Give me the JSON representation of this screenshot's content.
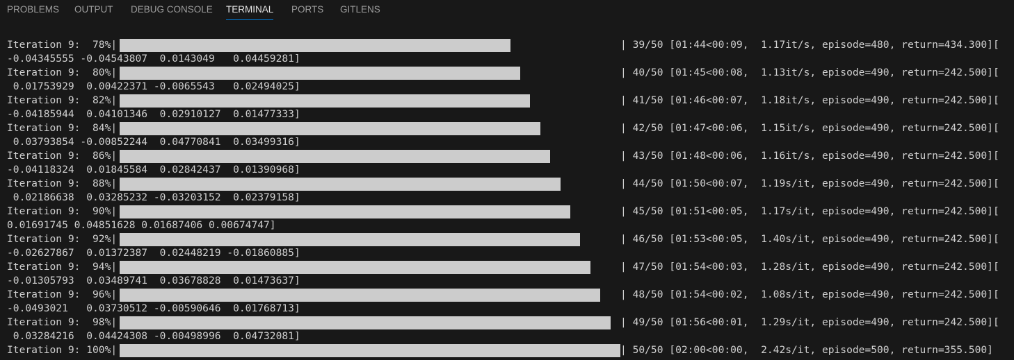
{
  "panel": {
    "tabs": [
      {
        "label": "PROBLEMS",
        "name": "tab-problems",
        "active": false
      },
      {
        "label": "OUTPUT",
        "name": "tab-output",
        "active": false
      },
      {
        "label": "DEBUG CONSOLE",
        "name": "tab-debug-console",
        "active": false
      },
      {
        "label": "TERMINAL",
        "name": "tab-terminal",
        "active": true
      },
      {
        "label": "PORTS",
        "name": "tab-ports",
        "active": false
      },
      {
        "label": "GITLENS",
        "name": "tab-gitlens",
        "active": false
      }
    ]
  },
  "terminal": {
    "progress_rows": [
      {
        "prefix": "Iteration 9:  78%|",
        "progress": 0.78,
        "suffix": "| 39/50 [01:44<00:09,  1.17it/s, episode=480, return=434.300][",
        "obs": "-0.04345555 -0.04543807  0.0143049   0.04459281]"
      },
      {
        "prefix": "Iteration 9:  80%|",
        "progress": 0.8,
        "suffix": "| 40/50 [01:45<00:08,  1.13it/s, episode=490, return=242.500][",
        "obs": " 0.01753929  0.00422371 -0.0065543   0.02494025]"
      },
      {
        "prefix": "Iteration 9:  82%|",
        "progress": 0.82,
        "suffix": "| 41/50 [01:46<00:07,  1.18it/s, episode=490, return=242.500][",
        "obs": "-0.04185944  0.04101346  0.02910127  0.01477333]"
      },
      {
        "prefix": "Iteration 9:  84%|",
        "progress": 0.84,
        "suffix": "| 42/50 [01:47<00:06,  1.15it/s, episode=490, return=242.500][",
        "obs": " 0.03793854 -0.00852244  0.04770841  0.03499316]"
      },
      {
        "prefix": "Iteration 9:  86%|",
        "progress": 0.86,
        "suffix": "| 43/50 [01:48<00:06,  1.16it/s, episode=490, return=242.500][",
        "obs": "-0.04118324  0.01845584  0.02842437  0.01390968]"
      },
      {
        "prefix": "Iteration 9:  88%|",
        "progress": 0.88,
        "suffix": "| 44/50 [01:50<00:07,  1.19s/it, episode=490, return=242.500][",
        "obs": " 0.02186638  0.03285232 -0.03203152  0.02379158]"
      },
      {
        "prefix": "Iteration 9:  90%|",
        "progress": 0.9,
        "suffix": "| 45/50 [01:51<00:05,  1.17s/it, episode=490, return=242.500][",
        "obs": "0.01691745 0.04851628 0.01687406 0.00674747]"
      },
      {
        "prefix": "Iteration 9:  92%|",
        "progress": 0.92,
        "suffix": "| 46/50 [01:53<00:05,  1.40s/it, episode=490, return=242.500][",
        "obs": "-0.02627867  0.01372387  0.02448219 -0.01860885]"
      },
      {
        "prefix": "Iteration 9:  94%|",
        "progress": 0.94,
        "suffix": "| 47/50 [01:54<00:03,  1.28s/it, episode=490, return=242.500][",
        "obs": "-0.01305793  0.03489741  0.03678828  0.01473637]"
      },
      {
        "prefix": "Iteration 9:  96%|",
        "progress": 0.96,
        "suffix": "| 48/50 [01:54<00:02,  1.08s/it, episode=490, return=242.500][",
        "obs": "-0.0493021   0.03730512 -0.00590646  0.01768713]"
      },
      {
        "prefix": "Iteration 9:  98%|",
        "progress": 0.98,
        "suffix": "| 49/50 [01:56<00:01,  1.29s/it, episode=490, return=242.500][",
        "obs": " 0.03284216  0.04424308 -0.00498996  0.04732081]"
      },
      {
        "prefix": "Iteration 9: 100%|",
        "progress": 1.0,
        "suffix": "| 50/50 [02:00<00:00,  2.42s/it, episode=500, return=355.500]",
        "obs": ""
      }
    ]
  },
  "colors": {
    "background": "#181818",
    "text": "#d0d0d0",
    "bar": "#cccccc",
    "tab_inactive": "#9d9d9d",
    "tab_active": "#e7e7e7",
    "tab_accent": "#0078d4"
  }
}
